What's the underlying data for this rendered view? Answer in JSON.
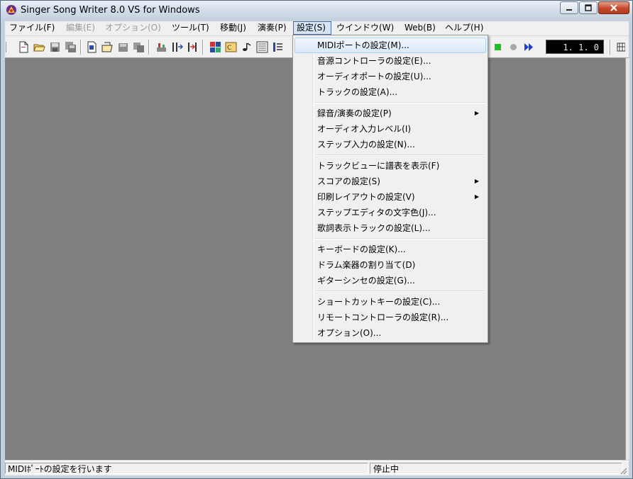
{
  "window": {
    "title": "Singer Song Writer 8.0 VS for Windows",
    "controls": [
      "minimize-icon",
      "maximize-icon",
      "close-icon"
    ]
  },
  "menubar": {
    "items": [
      {
        "label": "ファイル(F)",
        "state": "normal"
      },
      {
        "label": "編集(E)",
        "state": "disabled"
      },
      {
        "label": "オプション(O)",
        "state": "disabled"
      },
      {
        "label": "ツール(T)",
        "state": "normal"
      },
      {
        "label": "移動(J)",
        "state": "normal"
      },
      {
        "label": "演奏(P)",
        "state": "normal"
      },
      {
        "label": "設定(S)",
        "state": "active"
      },
      {
        "label": "ウインドウ(W)",
        "state": "normal"
      },
      {
        "label": "Web(B)",
        "state": "normal"
      },
      {
        "label": "ヘルプ(H)",
        "state": "normal"
      }
    ]
  },
  "toolbar": {
    "counter": "1.  1.   0"
  },
  "settings_menu": {
    "groups": [
      [
        {
          "label": "MIDIポートの設定(M)...",
          "highlighted": true,
          "submenu": false
        },
        {
          "label": "音源コントローラの設定(E)...",
          "highlighted": false,
          "submenu": false
        },
        {
          "label": "オーディオポートの設定(U)...",
          "highlighted": false,
          "submenu": false
        },
        {
          "label": "トラックの設定(A)...",
          "highlighted": false,
          "submenu": false
        }
      ],
      [
        {
          "label": "録音/演奏の設定(P)",
          "highlighted": false,
          "submenu": true
        },
        {
          "label": "オーディオ入力レベル(I)",
          "highlighted": false,
          "submenu": false
        },
        {
          "label": "ステップ入力の設定(N)...",
          "highlighted": false,
          "submenu": false
        }
      ],
      [
        {
          "label": "トラックビューに譜表を表示(F)",
          "highlighted": false,
          "submenu": false
        },
        {
          "label": "スコアの設定(S)",
          "highlighted": false,
          "submenu": true
        },
        {
          "label": "印刷レイアウトの設定(V)",
          "highlighted": false,
          "submenu": true
        },
        {
          "label": "ステップエディタの文字色(J)...",
          "highlighted": false,
          "submenu": false
        },
        {
          "label": "歌詞表示トラックの設定(L)...",
          "highlighted": false,
          "submenu": false
        }
      ],
      [
        {
          "label": "キーボードの設定(K)...",
          "highlighted": false,
          "submenu": false
        },
        {
          "label": "ドラム楽器の割り当て(D)",
          "highlighted": false,
          "submenu": false
        },
        {
          "label": "ギターシンセの設定(G)...",
          "highlighted": false,
          "submenu": false
        }
      ],
      [
        {
          "label": "ショートカットキーの設定(C)...",
          "highlighted": false,
          "submenu": false
        },
        {
          "label": "リモートコントローラの設定(R)...",
          "highlighted": false,
          "submenu": false
        },
        {
          "label": "オプション(O)...",
          "highlighted": false,
          "submenu": false
        }
      ]
    ]
  },
  "statusbar": {
    "message": "MIDIﾎﾟｰﾄの設定を行います",
    "state": "停止中"
  },
  "colors": {
    "workspace": "#808080",
    "menu_bg": "#f0f0f0",
    "highlight": "#dbe9fa",
    "counter_bg": "#000000"
  }
}
